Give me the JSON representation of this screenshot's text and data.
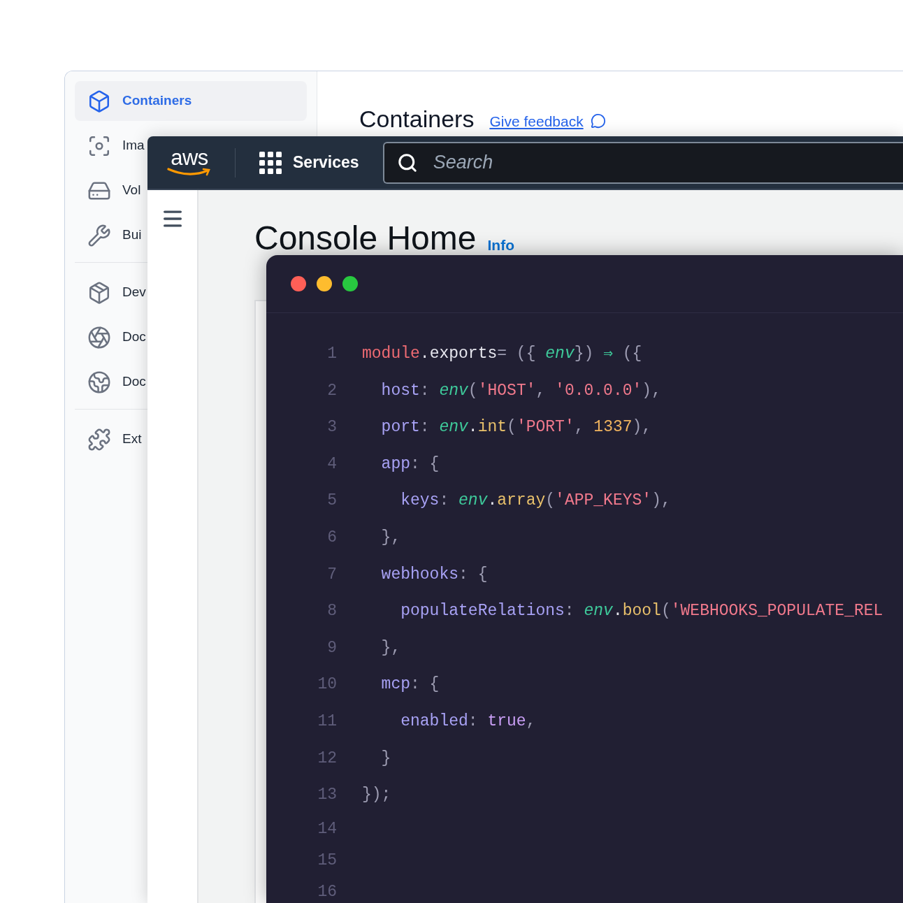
{
  "docker_window": {
    "sidebar": {
      "groups": [
        {
          "items": [
            {
              "label": "Containers",
              "selected": true
            },
            {
              "label": "Ima",
              "selected": false
            },
            {
              "label": "Vol",
              "selected": false
            },
            {
              "label": "Bui",
              "selected": false
            }
          ]
        },
        {
          "items": [
            {
              "label": "Dev",
              "selected": false
            },
            {
              "label": "Doc",
              "selected": false
            },
            {
              "label": "Doc",
              "selected": false
            }
          ]
        },
        {
          "items": [
            {
              "label": "Ext",
              "selected": false
            }
          ]
        }
      ]
    },
    "heading": "Containers",
    "feedback_link": "Give feedback"
  },
  "aws_window": {
    "logo": "aws",
    "services": "Services",
    "search": {
      "placeholder": "Search"
    },
    "heading": "Console Home",
    "info_link": "Info"
  },
  "editor_window": {
    "lines": [
      {
        "number": "1",
        "tokens": [
          {
            "text": "module",
            "kind": "keyword"
          },
          {
            "text": ".",
            "kind": "plain"
          },
          {
            "text": "exports",
            "kind": "plain"
          },
          {
            "text": "= ({ ",
            "kind": "punct"
          },
          {
            "text": "env",
            "kind": "param"
          },
          {
            "text": "}) ",
            "kind": "punct"
          },
          {
            "text": "⇒",
            "kind": "operator"
          },
          {
            "text": " ({",
            "kind": "punct"
          }
        ]
      },
      {
        "number": "2",
        "tokens": [
          {
            "text": "  host",
            "kind": "prop"
          },
          {
            "text": ": ",
            "kind": "punct"
          },
          {
            "text": "env",
            "kind": "param"
          },
          {
            "text": "(",
            "kind": "punct"
          },
          {
            "text": "'HOST'",
            "kind": "string"
          },
          {
            "text": ", ",
            "kind": "punct"
          },
          {
            "text": "'0.0.0.0'",
            "kind": "string"
          },
          {
            "text": "),",
            "kind": "punct"
          }
        ]
      },
      {
        "number": "3",
        "tokens": [
          {
            "text": "  port",
            "kind": "prop"
          },
          {
            "text": ": ",
            "kind": "punct"
          },
          {
            "text": "env",
            "kind": "param"
          },
          {
            "text": ".",
            "kind": "plain"
          },
          {
            "text": "int",
            "kind": "method"
          },
          {
            "text": "(",
            "kind": "punct"
          },
          {
            "text": "'PORT'",
            "kind": "string"
          },
          {
            "text": ", ",
            "kind": "punct"
          },
          {
            "text": "1337",
            "kind": "number"
          },
          {
            "text": "),",
            "kind": "punct"
          }
        ]
      },
      {
        "number": "4",
        "tokens": [
          {
            "text": "  app",
            "kind": "prop"
          },
          {
            "text": ": {",
            "kind": "punct"
          }
        ]
      },
      {
        "number": "5",
        "tokens": [
          {
            "text": "    keys",
            "kind": "prop"
          },
          {
            "text": ": ",
            "kind": "punct"
          },
          {
            "text": "env",
            "kind": "param"
          },
          {
            "text": ".",
            "kind": "plain"
          },
          {
            "text": "array",
            "kind": "method"
          },
          {
            "text": "(",
            "kind": "punct"
          },
          {
            "text": "'APP_KEYS'",
            "kind": "string"
          },
          {
            "text": "),",
            "kind": "punct"
          }
        ]
      },
      {
        "number": "6",
        "tokens": [
          {
            "text": "  },",
            "kind": "punct"
          }
        ]
      },
      {
        "number": "7",
        "tokens": [
          {
            "text": "  webhooks",
            "kind": "prop"
          },
          {
            "text": ": {",
            "kind": "punct"
          }
        ]
      },
      {
        "number": "8",
        "tokens": [
          {
            "text": "    populateRelations",
            "kind": "prop"
          },
          {
            "text": ": ",
            "kind": "punct"
          },
          {
            "text": "env",
            "kind": "param"
          },
          {
            "text": ".",
            "kind": "plain"
          },
          {
            "text": "bool",
            "kind": "method"
          },
          {
            "text": "(",
            "kind": "punct"
          },
          {
            "text": "'WEBHOOKS_POPULATE_REL",
            "kind": "string"
          }
        ]
      },
      {
        "number": "9",
        "tokens": [
          {
            "text": "  },",
            "kind": "punct"
          }
        ]
      },
      {
        "number": "10",
        "tokens": [
          {
            "text": "  mcp",
            "kind": "prop"
          },
          {
            "text": ": {",
            "kind": "punct"
          }
        ]
      },
      {
        "number": "11",
        "tokens": [
          {
            "text": "    enabled",
            "kind": "prop"
          },
          {
            "text": ": ",
            "kind": "punct"
          },
          {
            "text": "true",
            "kind": "boolean"
          },
          {
            "text": ",",
            "kind": "punct"
          }
        ]
      },
      {
        "number": "12",
        "tokens": [
          {
            "text": "  }",
            "kind": "punct"
          }
        ]
      },
      {
        "number": "13",
        "tokens": [
          {
            "text": "});",
            "kind": "punct"
          }
        ]
      },
      {
        "number": "14"
      },
      {
        "number": "15"
      },
      {
        "number": "16"
      }
    ]
  }
}
